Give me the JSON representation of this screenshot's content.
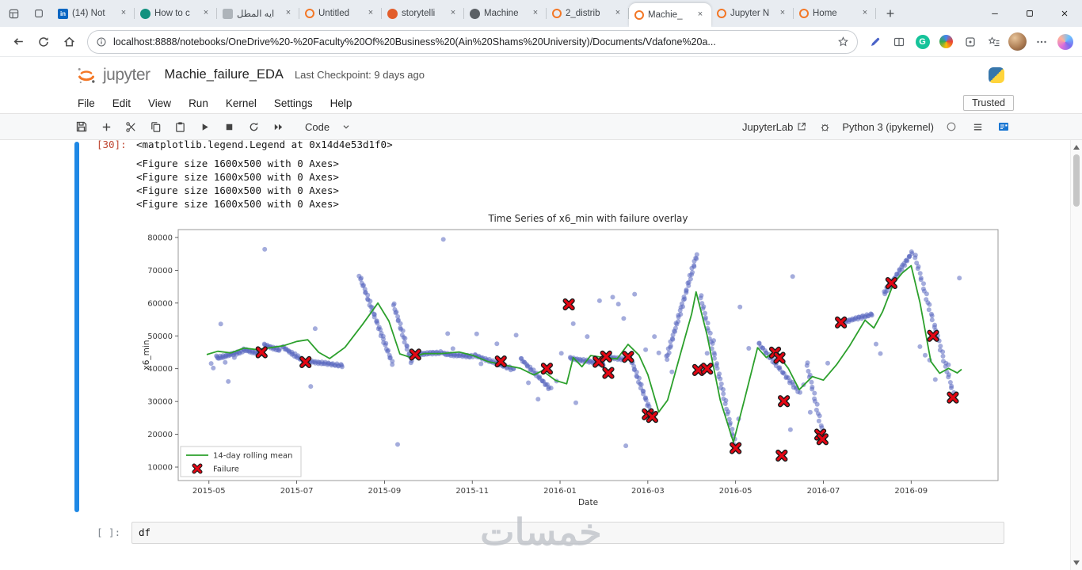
{
  "browser": {
    "tabbar_icons": [
      "tab-actions-icon",
      "workspaces-icon"
    ],
    "tabs": [
      {
        "title": "(14) Not",
        "icon": "linkedin-icon",
        "active": false
      },
      {
        "title": "How to c",
        "icon": "site-teal-icon",
        "active": false
      },
      {
        "title": "ايه المطل",
        "icon": "page-gray-icon",
        "active": false
      },
      {
        "title": "Untitled",
        "icon": "jupyter-icon",
        "active": false
      },
      {
        "title": "storytelli",
        "icon": "site-red-icon",
        "active": false
      },
      {
        "title": "Machine",
        "icon": "page-dark-icon",
        "active": false
      },
      {
        "title": "2_distrib",
        "icon": "jupyter-icon",
        "active": false
      },
      {
        "title": "Machie_",
        "icon": "jupyter-icon",
        "active": true
      },
      {
        "title": "Jupyter N",
        "icon": "jupyter-icon",
        "active": false
      },
      {
        "title": "Home",
        "icon": "jupyter-icon",
        "active": false
      }
    ],
    "new_tab": "+",
    "window_controls": [
      "minimize-icon",
      "maximize-icon",
      "close-icon"
    ],
    "nav_icons": [
      "back-icon",
      "refresh-icon",
      "home-icon"
    ],
    "url": "localhost:8888/notebooks/OneDrive%20-%20Faculty%20Of%20Business%20(Ain%20Shams%20University)/Documents/Vdafone%20a...",
    "url_icons": [
      "info-icon",
      "favorite-star-icon"
    ],
    "action_icons": [
      "edit-pen-icon",
      "split-screen-icon",
      "grammarly-icon",
      "extension-color-icon",
      "extension-gray-icon",
      "favorites-list-icon",
      "profile-avatar",
      "more-options-icon",
      "copilot-icon"
    ],
    "grammarly_letter": "G"
  },
  "jupyter": {
    "logo_text": "jupyter",
    "title": "Machie_failure_EDA",
    "checkpoint": "Last Checkpoint: 9 days ago",
    "menus": [
      "File",
      "Edit",
      "View",
      "Run",
      "Kernel",
      "Settings",
      "Help"
    ],
    "trusted": "Trusted",
    "toolbar_icons": [
      "save-icon",
      "add-cell-icon",
      "cut-icon",
      "copy-icon",
      "paste-icon",
      "run-icon",
      "stop-icon",
      "restart-icon",
      "run-all-icon"
    ],
    "cell_type": "Code",
    "jupyterlab_label": "JupyterLab",
    "kernel_name": "Python 3 (ipykernel)",
    "right_icons": [
      "debugger-icon",
      "kernel-status-icon",
      "hamburger-icon",
      "toc-icon"
    ]
  },
  "notebook": {
    "out_prompt": "[30]:",
    "out_line": "<matplotlib.legend.Legend at 0x14d4e53d1f0>",
    "figure_lines": [
      "<Figure size 1600x500 with 0 Axes>",
      "<Figure size 1600x500 with 0 Axes>",
      "<Figure size 1600x500 with 0 Axes>",
      "<Figure size 1600x500 with 0 Axes>"
    ],
    "next_prompt": "[ ]:",
    "next_code": "df",
    "watermark": "خمسات"
  },
  "chart_data": {
    "type": "scatter",
    "title": "Time Series of x6_min with failure overlay",
    "xlabel": "Date",
    "ylabel": "x6_min",
    "x_ticks": [
      "2015-05",
      "2015-07",
      "2015-09",
      "2015-11",
      "2016-01",
      "2016-03",
      "2016-05",
      "2016-07",
      "2016-09"
    ],
    "y_ticks": [
      10000,
      20000,
      30000,
      40000,
      50000,
      60000,
      70000,
      80000
    ],
    "x_domain_months": [
      -0.7,
      17.98
    ],
    "y_domain": [
      5900,
      82400
    ],
    "grid": false,
    "legend_position": "lower left",
    "legend": [
      {
        "label": "14-day rolling mean",
        "type": "line",
        "color": "#2ca02c"
      },
      {
        "label": "Failure",
        "type": "x-marker",
        "color": "#e30613"
      }
    ],
    "colors": {
      "scatter": "#5a68c0",
      "line": "#2ca02c",
      "failure": "#e30613",
      "spine": "#9a9a9a"
    },
    "rolling_mean": [
      [
        -0.05,
        44300
      ],
      [
        0.2,
        45300
      ],
      [
        0.5,
        44800
      ],
      [
        0.8,
        46300
      ],
      [
        1.1,
        45800
      ],
      [
        1.4,
        46400
      ],
      [
        1.7,
        47000
      ],
      [
        2.0,
        48300
      ],
      [
        2.25,
        48800
      ],
      [
        2.5,
        45000
      ],
      [
        2.75,
        43100
      ],
      [
        3.1,
        46500
      ],
      [
        3.5,
        53500
      ],
      [
        3.85,
        60000
      ],
      [
        4.1,
        54500
      ],
      [
        4.35,
        44500
      ],
      [
        4.6,
        43400
      ],
      [
        4.9,
        44600
      ],
      [
        5.3,
        44600
      ],
      [
        5.7,
        45100
      ],
      [
        6.0,
        44100
      ],
      [
        6.35,
        42200
      ],
      [
        6.7,
        41200
      ],
      [
        7.1,
        40100
      ],
      [
        7.4,
        38100
      ],
      [
        7.6,
        39400
      ],
      [
        7.9,
        36400
      ],
      [
        8.15,
        35400
      ],
      [
        8.3,
        43400
      ],
      [
        8.5,
        40600
      ],
      [
        8.7,
        44000
      ],
      [
        9.0,
        43400
      ],
      [
        9.3,
        43000
      ],
      [
        9.55,
        47400
      ],
      [
        9.8,
        44100
      ],
      [
        10.0,
        38200
      ],
      [
        10.25,
        26800
      ],
      [
        10.45,
        30400
      ],
      [
        10.75,
        44800
      ],
      [
        11.0,
        56800
      ],
      [
        11.1,
        63400
      ],
      [
        11.35,
        50200
      ],
      [
        11.65,
        30400
      ],
      [
        11.95,
        17600
      ],
      [
        12.2,
        30400
      ],
      [
        12.5,
        46400
      ],
      [
        12.7,
        43400
      ],
      [
        12.9,
        45400
      ],
      [
        13.2,
        40100
      ],
      [
        13.45,
        33600
      ],
      [
        13.75,
        37600
      ],
      [
        14.0,
        36500
      ],
      [
        14.3,
        41200
      ],
      [
        14.6,
        47000
      ],
      [
        14.95,
        54800
      ],
      [
        15.15,
        52400
      ],
      [
        15.35,
        57400
      ],
      [
        15.6,
        66000
      ],
      [
        15.8,
        69200
      ],
      [
        16.0,
        71400
      ],
      [
        16.2,
        60200
      ],
      [
        16.45,
        42200
      ],
      [
        16.65,
        38600
      ],
      [
        16.85,
        40100
      ],
      [
        17.05,
        38700
      ],
      [
        17.15,
        39800
      ]
    ],
    "scatter_streaks": [
      [
        0.18,
        43200,
        0.75,
        45200,
        26
      ],
      [
        0.78,
        45800,
        1.18,
        44600,
        18
      ],
      [
        1.25,
        47300,
        1.62,
        45600,
        16
      ],
      [
        1.68,
        46600,
        2.18,
        42100,
        22
      ],
      [
        2.25,
        42300,
        3.05,
        40900,
        30
      ],
      [
        3.45,
        67600,
        4.18,
        41600,
        40
      ],
      [
        4.2,
        59800,
        4.62,
        41900,
        24
      ],
      [
        4.68,
        44400,
        5.3,
        44900,
        26
      ],
      [
        5.35,
        44500,
        6.0,
        43700,
        26
      ],
      [
        6.05,
        44100,
        6.95,
        39700,
        32
      ],
      [
        7.1,
        43100,
        7.78,
        33800,
        28
      ],
      [
        8.22,
        43200,
        9.0,
        41400,
        30
      ],
      [
        9.05,
        43600,
        9.5,
        42800,
        16
      ],
      [
        9.58,
        44100,
        10.08,
        26200,
        28
      ],
      [
        10.42,
        42800,
        11.12,
        74800,
        44
      ],
      [
        11.2,
        62300,
        12.0,
        16200,
        44
      ],
      [
        12.52,
        47800,
        13.45,
        32800,
        34
      ],
      [
        13.62,
        41800,
        14.0,
        19400,
        20
      ],
      [
        14.35,
        53900,
        15.12,
        56600,
        30
      ],
      [
        15.38,
        62800,
        16.02,
        75400,
        32
      ],
      [
        16.08,
        74600,
        16.98,
        31600,
        40
      ]
    ],
    "scatter_points": [
      [
        0.05,
        41600
      ],
      [
        0.1,
        40200
      ],
      [
        0.17,
        43900
      ],
      [
        0.27,
        53600
      ],
      [
        0.37,
        41900
      ],
      [
        0.44,
        36100
      ],
      [
        0.58,
        43400
      ],
      [
        1.27,
        76400
      ],
      [
        2.32,
        34600
      ],
      [
        2.42,
        52200
      ],
      [
        3.42,
        68200
      ],
      [
        4.3,
        16900
      ],
      [
        5.34,
        79400
      ],
      [
        5.44,
        50700
      ],
      [
        5.56,
        46100
      ],
      [
        6.1,
        50600
      ],
      [
        6.2,
        41500
      ],
      [
        6.56,
        47600
      ],
      [
        7.0,
        50200
      ],
      [
        7.28,
        35700
      ],
      [
        7.5,
        30700
      ],
      [
        7.92,
        36200
      ],
      [
        8.03,
        44700
      ],
      [
        8.3,
        53700
      ],
      [
        8.36,
        29600
      ],
      [
        8.62,
        49800
      ],
      [
        8.9,
        60700
      ],
      [
        9.2,
        61800
      ],
      [
        9.33,
        59700
      ],
      [
        9.45,
        55300
      ],
      [
        9.5,
        16500
      ],
      [
        9.7,
        62700
      ],
      [
        9.95,
        45800
      ],
      [
        10.15,
        49800
      ],
      [
        10.25,
        44800
      ],
      [
        10.55,
        39000
      ],
      [
        11.35,
        44700
      ],
      [
        11.5,
        48600
      ],
      [
        12.07,
        24700
      ],
      [
        12.1,
        58800
      ],
      [
        12.3,
        46200
      ],
      [
        13.25,
        21400
      ],
      [
        13.3,
        68100
      ],
      [
        13.55,
        35100
      ],
      [
        13.7,
        26700
      ],
      [
        14.1,
        41700
      ],
      [
        15.2,
        47500
      ],
      [
        15.3,
        44600
      ],
      [
        16.2,
        46700
      ],
      [
        16.32,
        44100
      ],
      [
        16.42,
        42600
      ],
      [
        16.55,
        36700
      ],
      [
        16.85,
        41200
      ],
      [
        17.1,
        67600
      ]
    ],
    "failures": [
      [
        1.2,
        45000
      ],
      [
        2.2,
        42000
      ],
      [
        4.7,
        44300
      ],
      [
        6.65,
        42200
      ],
      [
        7.7,
        40000
      ],
      [
        8.2,
        59600
      ],
      [
        8.88,
        42100
      ],
      [
        9.05,
        43700
      ],
      [
        9.1,
        38700
      ],
      [
        9.55,
        43600
      ],
      [
        10.0,
        26100
      ],
      [
        10.1,
        25300
      ],
      [
        11.15,
        39600
      ],
      [
        11.35,
        40000
      ],
      [
        12.0,
        15800
      ],
      [
        12.9,
        44900
      ],
      [
        13.0,
        43300
      ],
      [
        13.1,
        30100
      ],
      [
        13.05,
        13500
      ],
      [
        13.93,
        19900
      ],
      [
        13.98,
        18500
      ],
      [
        14.4,
        54100
      ],
      [
        15.55,
        66100
      ],
      [
        16.5,
        50000
      ],
      [
        16.95,
        31200
      ]
    ]
  }
}
